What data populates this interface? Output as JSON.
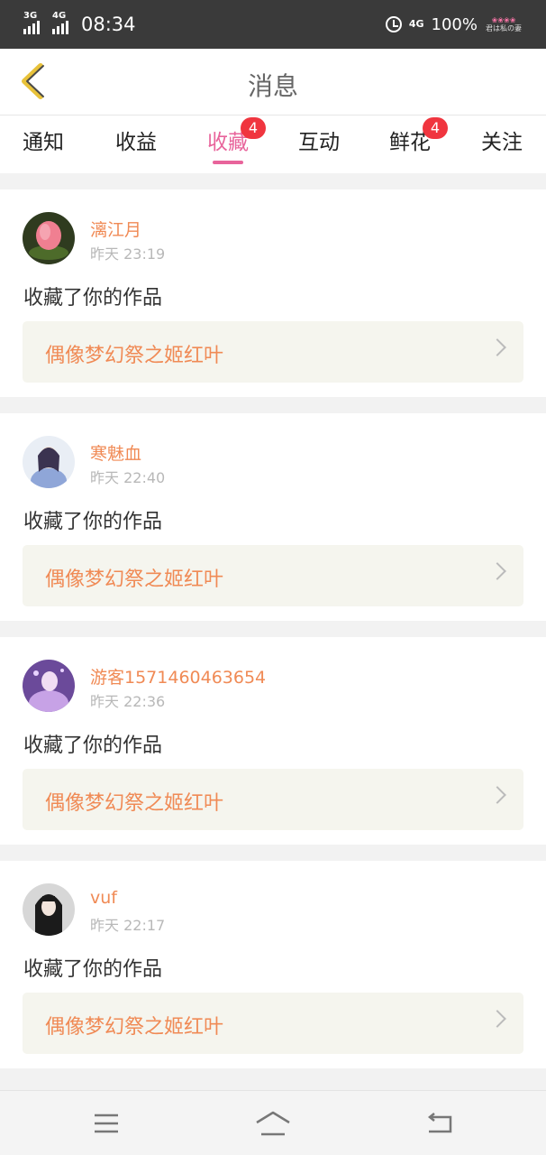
{
  "status": {
    "sim1": "3G",
    "sim2": "4G",
    "time": "08:34",
    "net": "4G",
    "battery": "100%",
    "deco_text": "君は私の妻"
  },
  "header": {
    "title": "消息"
  },
  "tabs": [
    {
      "label": "通知",
      "badge": ""
    },
    {
      "label": "收益",
      "badge": ""
    },
    {
      "label": "收藏",
      "badge": "4"
    },
    {
      "label": "互动",
      "badge": ""
    },
    {
      "label": "鲜花",
      "badge": "4"
    },
    {
      "label": "关注",
      "badge": ""
    }
  ],
  "messages": [
    {
      "name": "漓江月",
      "time": "昨天 23:19",
      "action": "收藏了你的作品",
      "work": "偶像梦幻祭之姬红叶"
    },
    {
      "name": "寒魅血",
      "time": "昨天 22:40",
      "action": "收藏了你的作品",
      "work": "偶像梦幻祭之姬红叶"
    },
    {
      "name": "游客1571460463654",
      "time": "昨天 22:36",
      "action": "收藏了你的作品",
      "work": "偶像梦幻祭之姬红叶"
    },
    {
      "name": "vuf",
      "time": "昨天 22:17",
      "action": "收藏了你的作品",
      "work": "偶像梦幻祭之姬红叶"
    }
  ],
  "colors": {
    "accent": "#e8649b",
    "name": "#f08a55",
    "badge": "#f0353f",
    "back": "#e8c23a"
  }
}
